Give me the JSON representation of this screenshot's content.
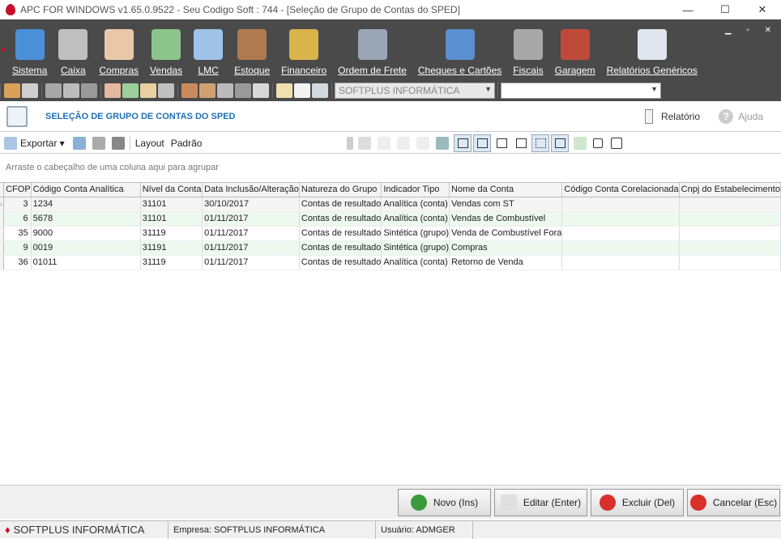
{
  "window": {
    "title": "APC FOR WINDOWS v1.65.0.9522 - Seu Codigo Soft : 744  - [Seleção de Grupo de Contas do SPED]",
    "controls": [
      "—",
      "☐",
      "✕"
    ]
  },
  "menu": [
    {
      "label": "Sistema",
      "icon": "computer-icon",
      "color": "#4a90d9"
    },
    {
      "label": "Caixa",
      "icon": "cash-register-icon",
      "color": "#bfbfbf"
    },
    {
      "label": "Compras",
      "icon": "invoice-icon",
      "color": "#e8c8a8"
    },
    {
      "label": "Vendas",
      "icon": "calculator-icon",
      "color": "#8cc58c"
    },
    {
      "label": "LMC",
      "icon": "document-icon",
      "color": "#9fc3e8"
    },
    {
      "label": "Estoque",
      "icon": "boxes-icon",
      "color": "#b07a50"
    },
    {
      "label": "Financeiro",
      "icon": "money-icon",
      "color": "#d9b44a"
    },
    {
      "label": "Ordem de Frete",
      "icon": "truck-icon",
      "color": "#9aa6b4"
    },
    {
      "label": "Cheques e Cartões",
      "icon": "card-icon",
      "color": "#5b8fd0"
    },
    {
      "label": "Fiscais",
      "icon": "coins-icon",
      "color": "#a8a8a8"
    },
    {
      "label": "Garagem",
      "icon": "car-icon",
      "color": "#c04a3a"
    },
    {
      "label": "Relatórios Genéricos",
      "icon": "report-icon",
      "color": "#dfe6ee"
    }
  ],
  "menu_controls": "▁ ▫ ✕",
  "company_combo": "SOFTPLUS INFORMÁTICA",
  "header": {
    "title": "SELEÇÃO DE GRUPO DE CONTAS DO SPED",
    "report": "Relatório",
    "help": "Ajuda"
  },
  "grid_toolbar": {
    "export": "Exportar ▾",
    "layout": "Layout",
    "layout_value": "Padrão"
  },
  "group_hint": "Arraste o cabeçalho de uma coluna aqui para agrupar",
  "columns": [
    "CFOP",
    "Código Conta Analítica",
    "Nível da Conta",
    "Data Inclusão/Alteração",
    "Natureza do Grupo",
    "Indicador Tipo",
    "Nome da Conta",
    "Código Conta Corelacionada",
    "Cnpj do Estabelecimento"
  ],
  "rows": [
    {
      "cfop": "3",
      "codigo": "1234",
      "nivel": "31101",
      "data": "30/10/2017",
      "natureza": "Contas de resultado",
      "indicador": "Analítica (conta)",
      "nome": "Vendas com ST"
    },
    {
      "cfop": "6",
      "codigo": "5678",
      "nivel": "31101",
      "data": "01/11/2017",
      "natureza": "Contas de resultado",
      "indicador": "Analítica (conta)",
      "nome": "Vendas de Combustível"
    },
    {
      "cfop": "35",
      "codigo": "9000",
      "nivel": "31119",
      "data": "01/11/2017",
      "natureza": "Contas de resultado",
      "indicador": "Sintética (grupo)",
      "nome": "Venda de Combustível Fora"
    },
    {
      "cfop": "9",
      "codigo": "0019",
      "nivel": "31191",
      "data": "01/11/2017",
      "natureza": "Contas de resultado",
      "indicador": "Sintética (grupo)",
      "nome": "Compras"
    },
    {
      "cfop": "36",
      "codigo": "01011",
      "nivel": "31119",
      "data": "01/11/2017",
      "natureza": "Contas de resultado",
      "indicador": "Analítica (conta)",
      "nome": "Retorno de Venda"
    }
  ],
  "buttons": {
    "new": "Novo (Ins)",
    "edit": "Editar (Enter)",
    "delete": "Excluir (Del)",
    "cancel": "Cancelar (Esc)"
  },
  "status": {
    "brand": "SOFTPLUS INFORMÁTICA",
    "company": "Empresa: SOFTPLUS INFORMÁTICA",
    "user": "Usuário: ADMGER"
  }
}
